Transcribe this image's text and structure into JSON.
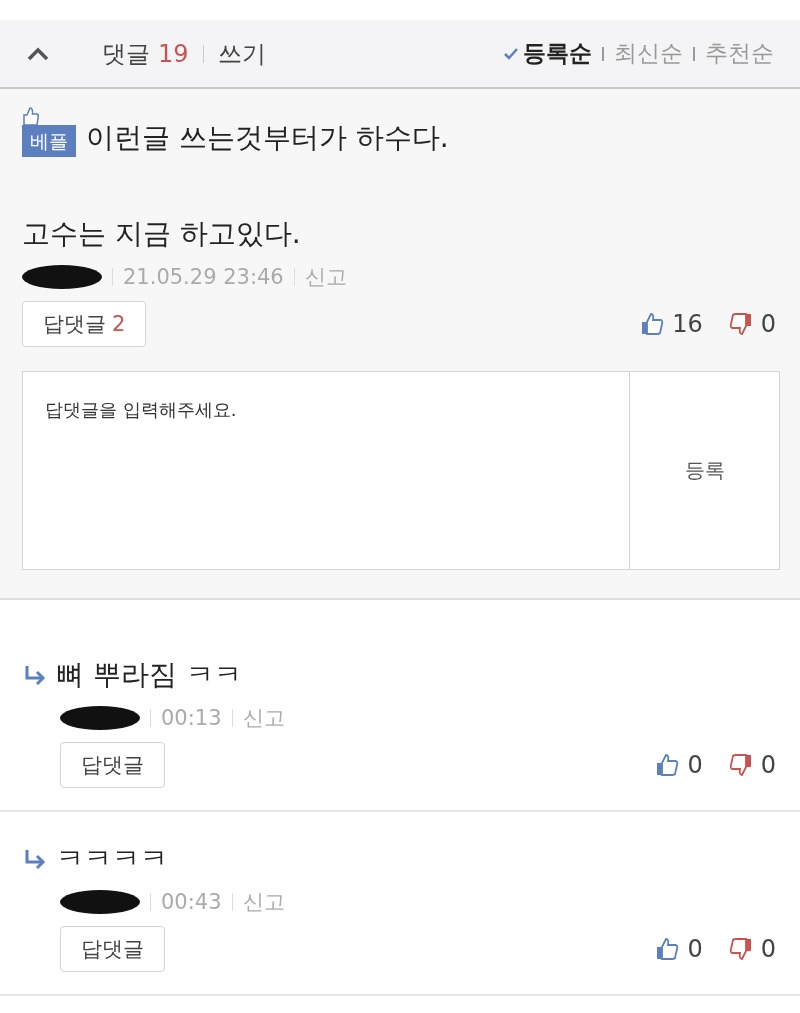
{
  "header": {
    "comments_label": "댓글",
    "comment_count": "19",
    "write_link": "쓰기",
    "sort_options": [
      {
        "label": "등록순",
        "selected": true
      },
      {
        "label": "최신순",
        "selected": false
      },
      {
        "label": "추천순",
        "selected": false
      }
    ]
  },
  "best_comment": {
    "badge": "베플",
    "lines": [
      "이런글 쓰는것부터가 하수다.",
      "고수는 지금 하고있다."
    ],
    "date": "21.05.29  23:46",
    "report": "신고",
    "reply_button": "답댓글",
    "reply_count": "2",
    "likes": "16",
    "dislikes": "0"
  },
  "reply_form": {
    "placeholder": "답댓글을 입력해주세요.",
    "submit": "등록"
  },
  "replies": [
    {
      "text": "뼈 뿌라짐 ㅋㅋ",
      "time": "00:13",
      "report": "신고",
      "reply_button": "답댓글",
      "likes": "0",
      "dislikes": "0"
    },
    {
      "text": "ㅋㅋㅋㅋ",
      "time": "00:43",
      "report": "신고",
      "reply_button": "답댓글",
      "likes": "0",
      "dislikes": "0"
    }
  ]
}
